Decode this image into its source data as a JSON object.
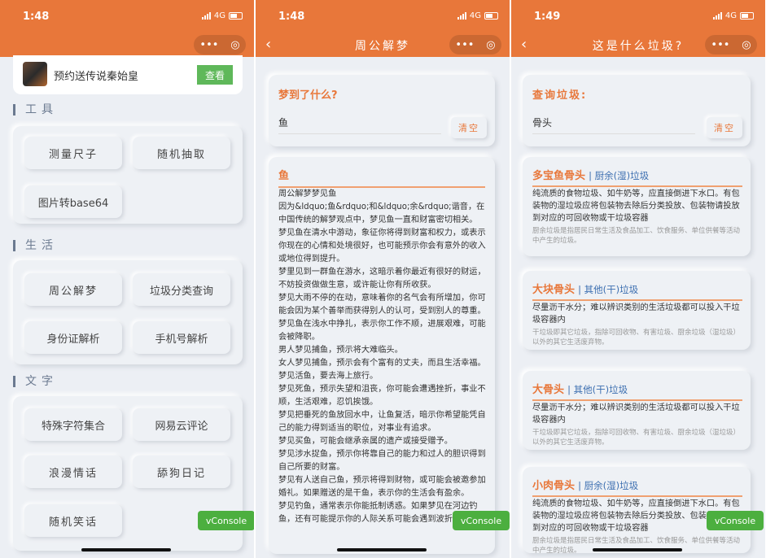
{
  "status": {
    "signal": "4G",
    "times": [
      "1:48",
      "1:48",
      "1:49"
    ]
  },
  "capsule": {
    "more": "•••",
    "close": "◎"
  },
  "home": {
    "ad": {
      "text": "预约送传说秦始皇",
      "button": "查看"
    },
    "sections": [
      {
        "title": "工具",
        "items": [
          "测量尺子",
          "随机抽取",
          "图片转base64"
        ]
      },
      {
        "title": "生活",
        "items": [
          "周公解梦",
          "垃圾分类查询",
          "身份证解析",
          "手机号解析"
        ]
      },
      {
        "title": "文字",
        "items": [
          "特殊字符集合",
          "网易云评论",
          "浪漫情话",
          "舔狗日记",
          "随机笑话"
        ]
      }
    ]
  },
  "dream": {
    "title": "周公解梦",
    "back": "‹",
    "prompt": "梦到了什么?",
    "input_value": "鱼",
    "clear": "清空",
    "result_title": "鱼",
    "lines": [
      "周公解梦梦见鱼",
      "因为&ldquo;鱼&rdquo;和&ldquo;余&rdquo;谐音，在中国传统的解梦观点中，梦见鱼一直和财富密切相关。",
      "梦见鱼在清水中游动，象征你将得到财富和权力，或表示你现在的心情和处境很好，也可能预示你会有意外的收入或地位得到提升。",
      "梦里见到一群鱼在游水，这暗示着你最近有很好的财运，不妨投资做做生意，或许能让你有所收获。",
      "梦见大雨不停的在动，意味着你的名气会有所增加，你可能会因为某个善举而获得别人的认可，受到别人的尊重。",
      "梦见鱼在浅水中挣扎，表示你工作不顺，进展艰难，可能会被降职。",
      "男人梦见捕鱼，预示将大难临头。",
      "女人梦见捕鱼，预示会有个富有的丈夫，而且生活幸福。",
      "梦见活鱼，要去海上旅行。",
      "梦见死鱼，预示失望和沮丧，你可能会遭遇挫折，事业不顺，生活艰难，忍饥挨饿。",
      "梦见把垂死的鱼放回水中，让鱼复活，暗示你希望能凭自己的能力得到适当的职位，对事业有追求。",
      "梦见买鱼，可能会继承亲属的遗产或接受赠予。",
      "梦见涉水捉鱼，预示你将靠自己的能力和过人的胆识得到自己所要的财富。",
      "梦见有人送自己鱼，预示将得到财物，或可能会被邀参加婚礼。如果赠送的是干鱼，表示你的生活会有盈余。",
      "梦见钓鱼，通常表示你能抵制诱惑。如果梦见在河边钓鱼，还有可能提示你的人际关系可能会遇到波折。"
    ]
  },
  "garbage": {
    "title": "这是什么垃圾?",
    "back": "‹",
    "prompt": "查询垃圾:",
    "input_value": "骨头",
    "clear": "清空",
    "results": [
      {
        "name": "多宝鱼骨头",
        "cat": "| 厨余(湿)垃圾",
        "desc": "纯流质的食物垃圾、如牛奶等，应直接倒进下水口。有包装物的湿垃圾应将包装物去除后分类投放、包装物请投放到对应的可回收物或干垃圾容器",
        "explain": "厨余垃圾是指居民日常生活及食品加工、饮食服务、单位供餐等活动中产生的垃圾。"
      },
      {
        "name": "大块骨头",
        "cat": "| 其他(干)垃圾",
        "desc": "尽量沥干水分；难以辨识类别的生活垃圾都可以投入干垃圾容器内",
        "explain": "干垃圾即其它垃圾，指除可回收物、有害垃圾、厨余垃圾（湿垃圾）以外的其它生活废弃物。"
      },
      {
        "name": "大骨头",
        "cat": "| 其他(干)垃圾",
        "desc": "尽量沥干水分；难以辨识类别的生活垃圾都可以投入干垃圾容器内",
        "explain": "干垃圾即其它垃圾，指除可回收物、有害垃圾、厨余垃圾（湿垃圾）以外的其它生活废弃物。"
      },
      {
        "name": "小肉骨头",
        "cat": "| 厨余(湿)垃圾",
        "desc": "纯流质的食物垃圾、如牛奶等，应直接倒进下水口。有包装物的湿垃圾应将包装物去除后分类投放、包装物请投放到对应的可回收物或干垃圾容器",
        "explain": "厨余垃圾是指居民日常生活及食品加工、饮食服务、单位供餐等活动中产生的垃圾。"
      }
    ]
  },
  "vconsole": "vConsole"
}
